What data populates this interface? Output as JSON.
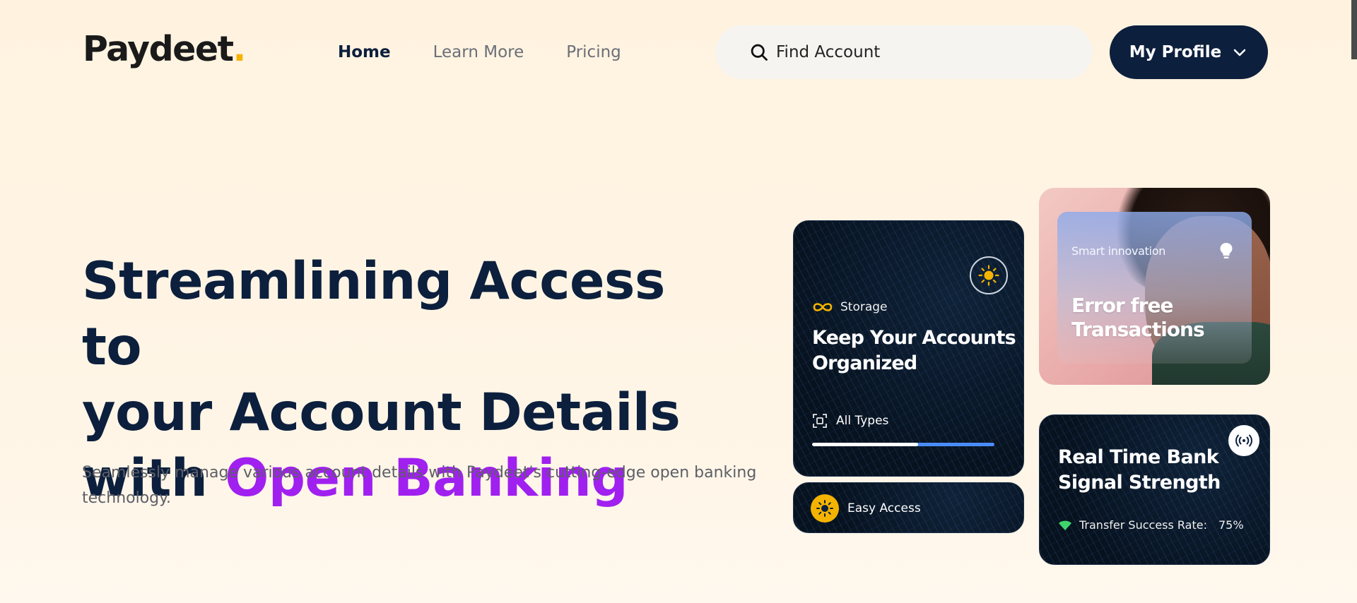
{
  "brand": {
    "name": "Paydeet",
    "dot": "."
  },
  "nav": {
    "items": [
      {
        "label": "Home",
        "active": true
      },
      {
        "label": "Learn More",
        "active": false
      },
      {
        "label": "Pricing",
        "active": false
      }
    ]
  },
  "search": {
    "placeholder": "Find Account",
    "icon": "search-icon"
  },
  "profile": {
    "label": "My Profile",
    "icon": "chevron-down-icon"
  },
  "hero": {
    "title_line1": "Streamlining Access to",
    "title_line2": "your Account Details",
    "title_line3_prefix": "with ",
    "title_accent": "Open Banking",
    "subtitle": "Seamlessly manage various account details with Paydeet's cutting-edge open banking technology."
  },
  "cards": {
    "storage": {
      "tag": "Storage",
      "title": "Keep Your Accounts Organized",
      "types_label": "All Types",
      "progress_percent": 58
    },
    "easy": {
      "label": "Easy Access"
    },
    "photo": {
      "tag": "Smart innovation",
      "title": "Error free Transactions"
    },
    "signal": {
      "title": "Real Time Bank Signal Strength",
      "rate_label": "Transfer Success Rate:",
      "rate_value": "75%"
    }
  },
  "colors": {
    "navy": "#0c1f3d",
    "accent_purple": "#a020f0",
    "accent_yellow": "#f5b301",
    "progress_blue": "#4a8cf7",
    "background": "#fff3e0"
  }
}
